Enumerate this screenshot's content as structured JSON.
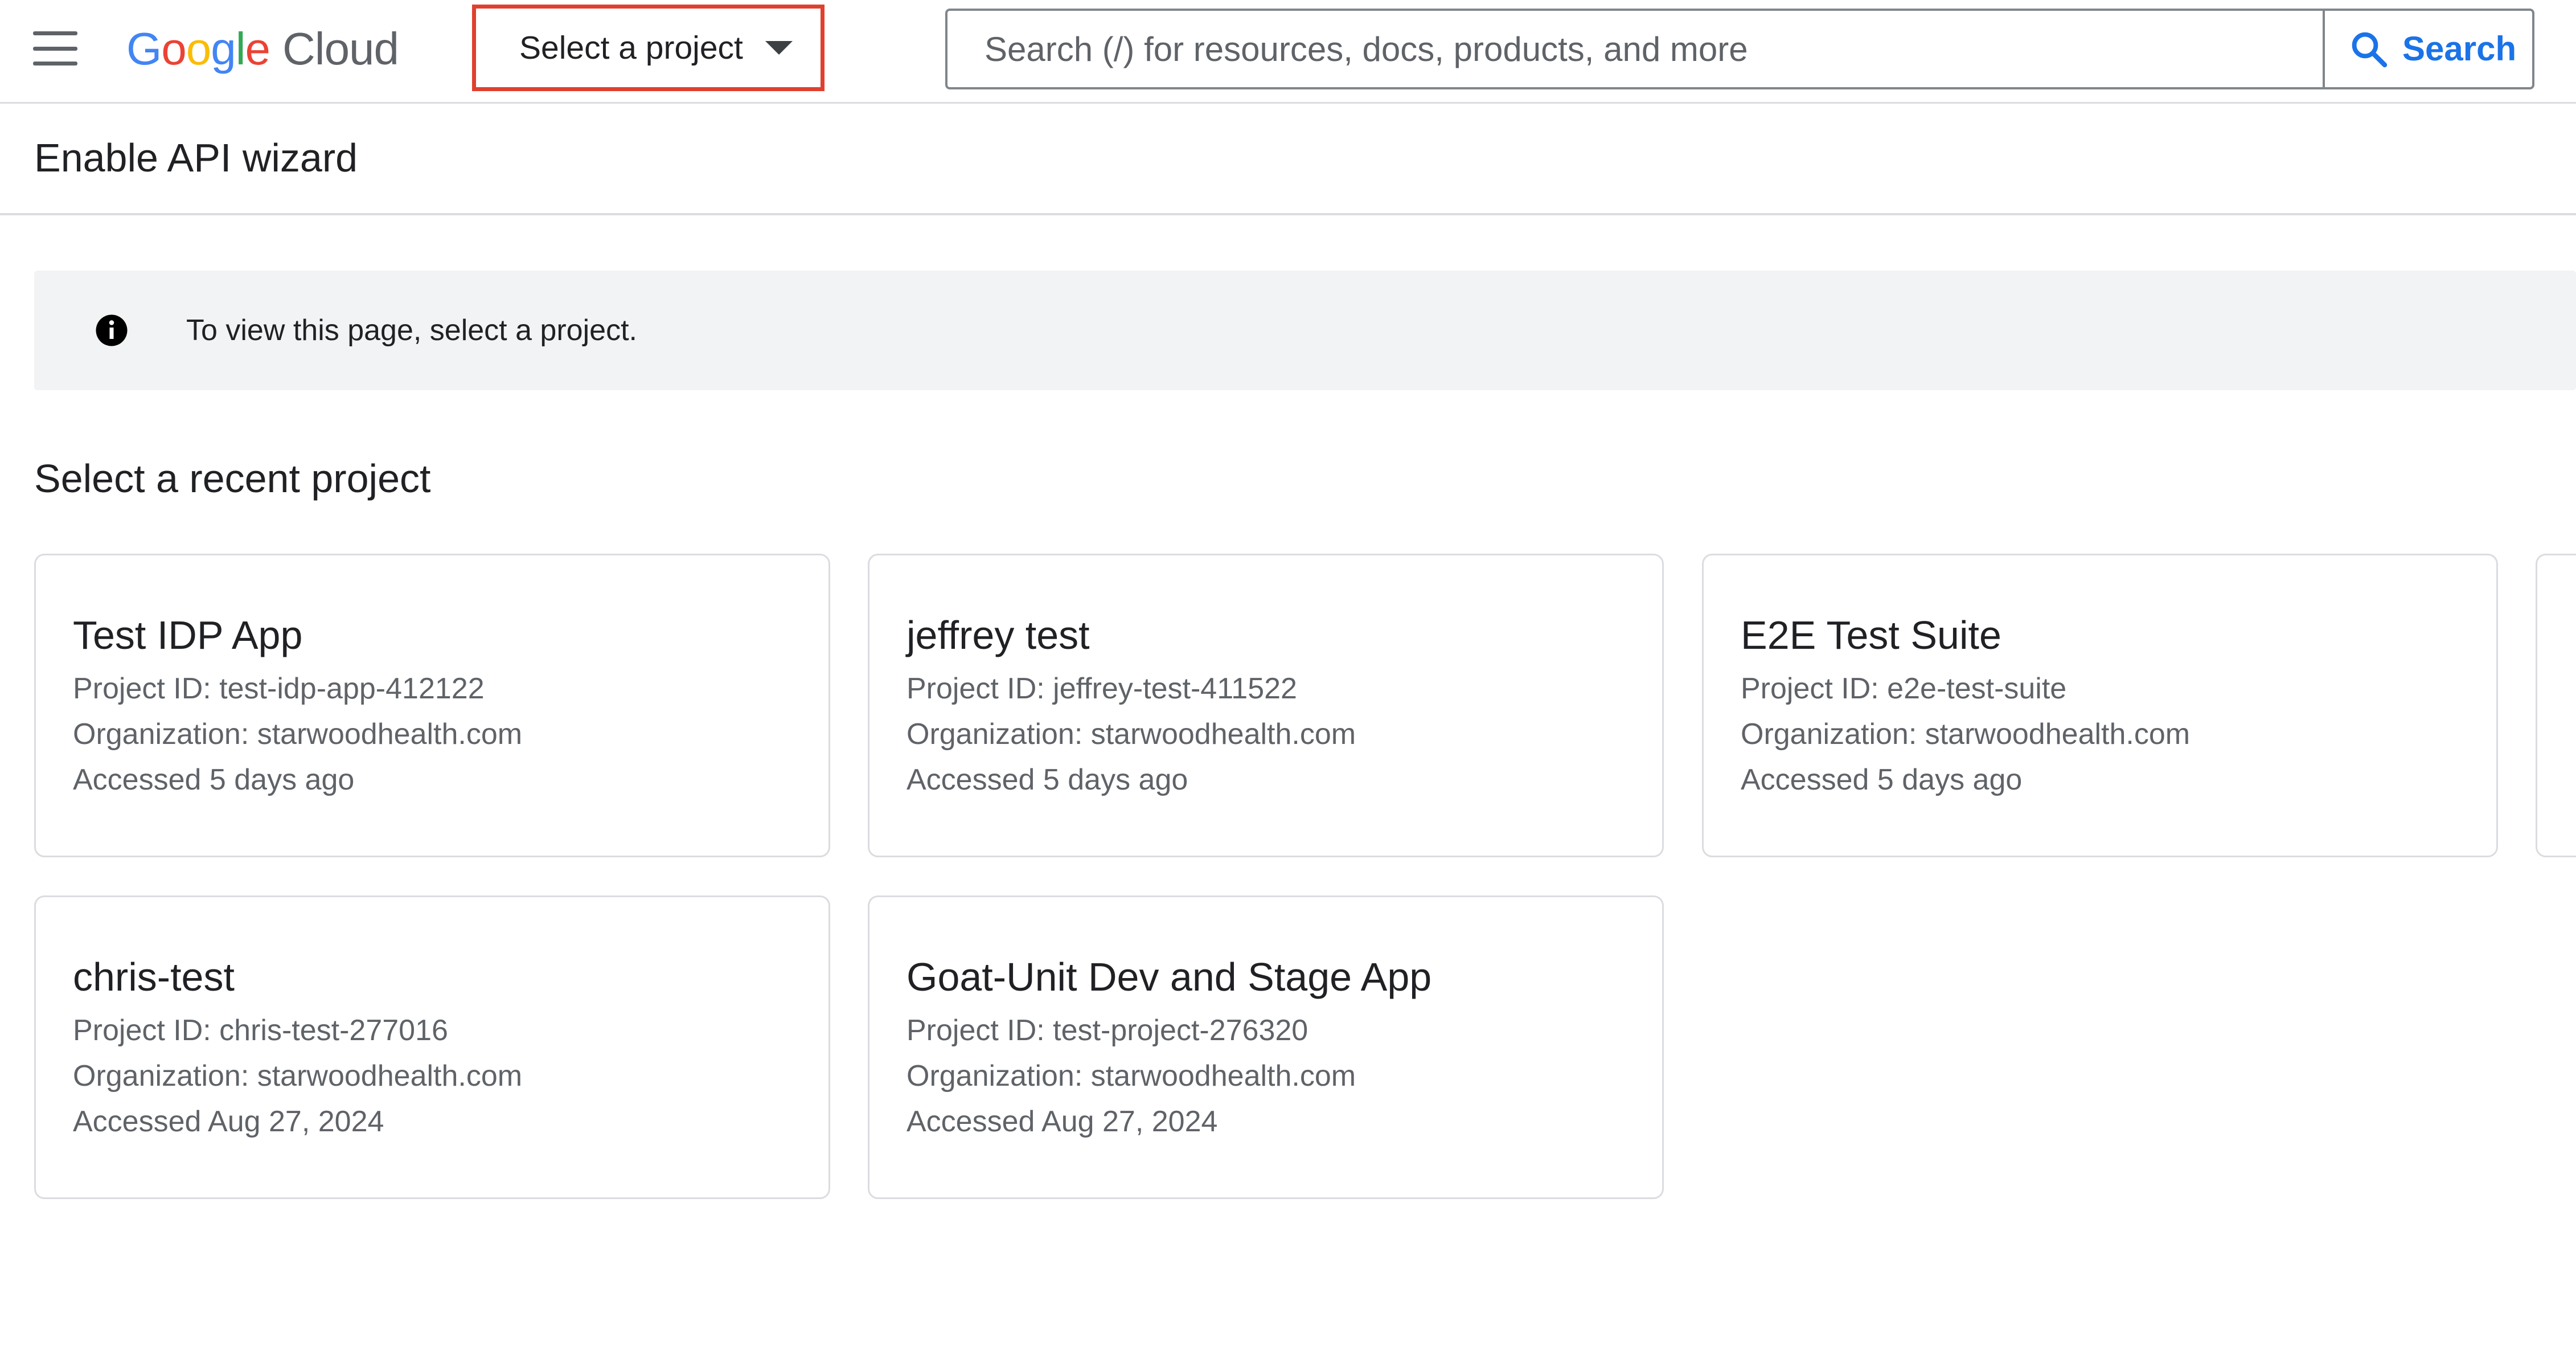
{
  "header": {
    "logo_google": "Google",
    "logo_cloud": "Cloud",
    "project_picker_label": "Select a project",
    "search_placeholder": "Search (/) for resources, docs, products, and more",
    "search_button_label": "Search"
  },
  "page": {
    "title": "Enable API wizard"
  },
  "info_banner": {
    "text": "To view this page, select a project."
  },
  "recent_projects": {
    "title": "Select a recent project",
    "items": [
      {
        "name": "Test IDP App",
        "project_id": "Project ID: test-idp-app-412122",
        "organization": "Organization: starwoodhealth.com",
        "accessed": "Accessed 5 days ago"
      },
      {
        "name": "jeffrey test",
        "project_id": "Project ID: jeffrey-test-411522",
        "organization": "Organization: starwoodhealth.com",
        "accessed": "Accessed 5 days ago"
      },
      {
        "name": "E2E Test Suite",
        "project_id": "Project ID: e2e-test-suite",
        "organization": "Organization: starwoodhealth.com",
        "accessed": "Accessed 5 days ago"
      },
      {
        "name": "chris-test",
        "project_id": "Project ID: chris-test-277016",
        "organization": "Organization: starwoodhealth.com",
        "accessed": "Accessed Aug 27, 2024"
      },
      {
        "name": "Goat-Unit Dev and Stage App",
        "project_id": "Project ID: test-project-276320",
        "organization": "Organization: starwoodhealth.com",
        "accessed": "Accessed Aug 27, 2024"
      }
    ]
  },
  "colors": {
    "google_blue": "#4285F4",
    "google_red": "#EA4335",
    "google_yellow": "#FBBC05",
    "google_green": "#34A853",
    "accent_blue": "#1a73e8",
    "highlight_red": "#e0402e",
    "banner_bg": "#f1f3f4"
  },
  "icons": {
    "menu": "menu-icon",
    "dropdown": "caret-down-icon",
    "search": "search-icon",
    "info": "info-icon"
  }
}
